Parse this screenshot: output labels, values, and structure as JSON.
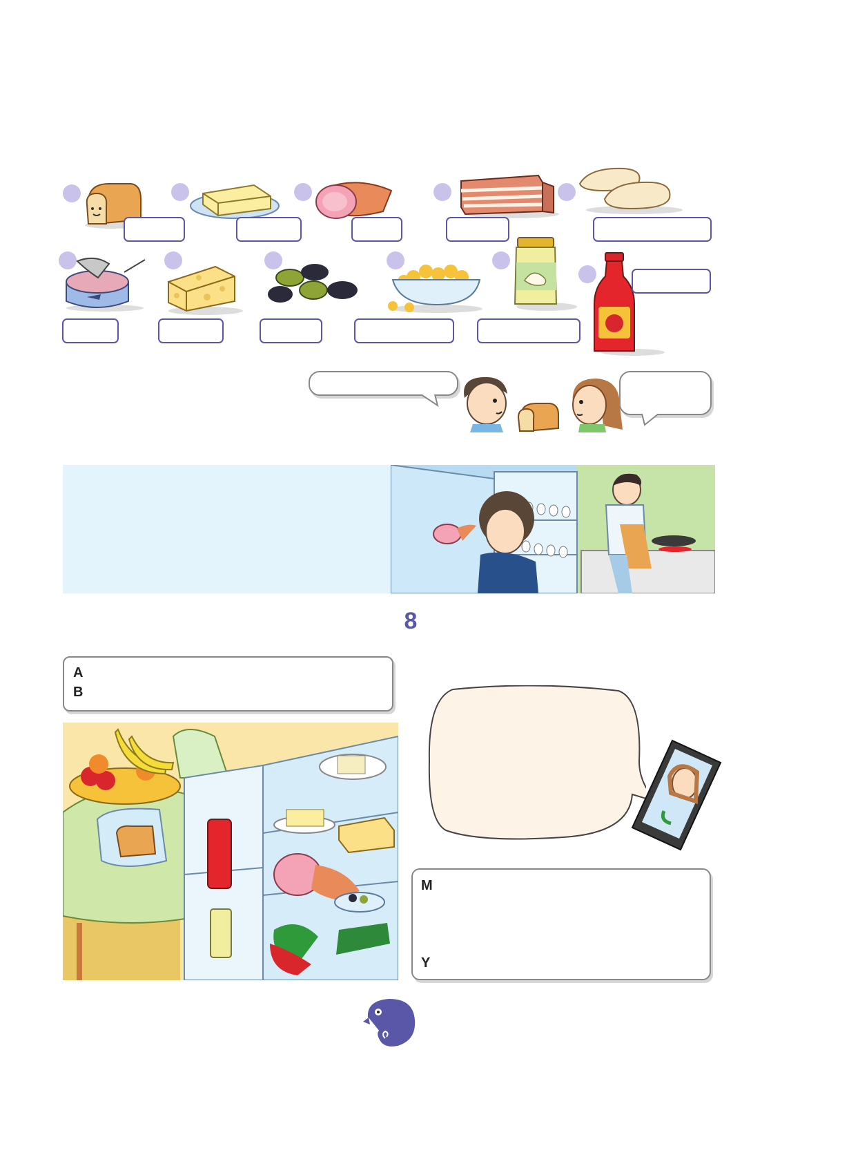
{
  "page": {
    "unit_number": "8"
  },
  "dialogue_box_1": {
    "label_a": "A",
    "label_b": "B"
  },
  "phone_box": {
    "label_m": "M",
    "label_y": "Y"
  },
  "colors": {
    "accent": "#5a57a8",
    "dot": "#c9c3ec",
    "panel_bg": "#e4f4fc",
    "speech_bg": "#fdf3e6"
  },
  "food_items": [
    {
      "icon": "bread-icon"
    },
    {
      "icon": "butter-icon"
    },
    {
      "icon": "ham-icon"
    },
    {
      "icon": "bacon-icon"
    },
    {
      "icon": "pitta-bread-icon"
    },
    {
      "icon": "tuna-can-icon"
    },
    {
      "icon": "cheese-icon"
    },
    {
      "icon": "olives-icon"
    },
    {
      "icon": "corn-bowl-icon"
    },
    {
      "icon": "mayonnaise-jar-icon"
    },
    {
      "icon": "ketchup-bottle-icon"
    }
  ],
  "logo": {
    "icon": "chameleon-logo-icon"
  }
}
